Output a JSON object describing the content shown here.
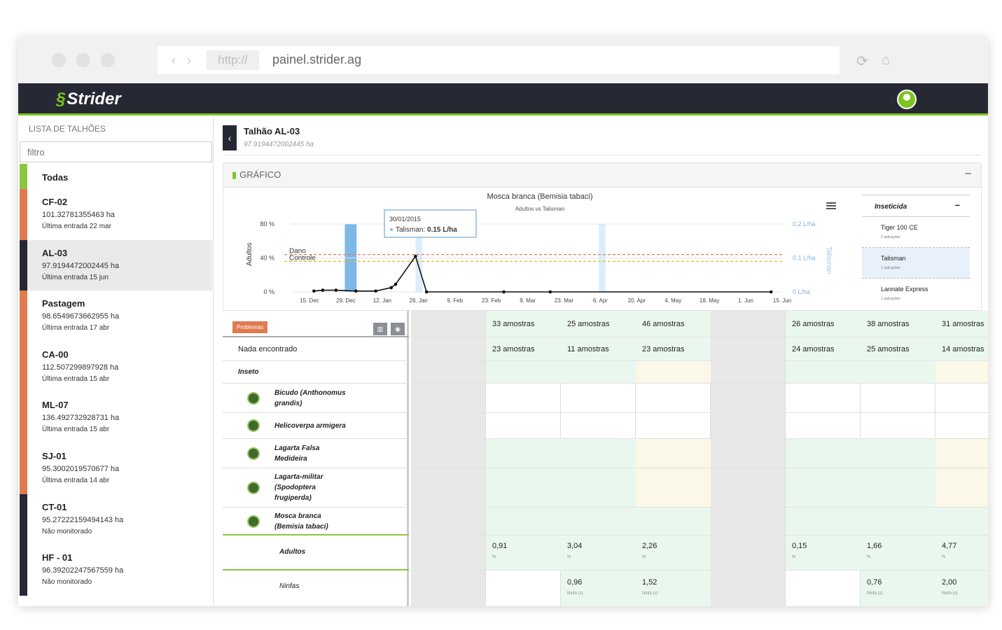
{
  "browser": {
    "protocol": "http://",
    "url": "painel.strider.ag"
  },
  "app": {
    "logo": "Strider"
  },
  "sidebar": {
    "title": "LISTA DE TALHÕES",
    "filter_placeholder": "filtro",
    "todas": "Todas",
    "items": [
      {
        "name": "CF-02",
        "area": "101.32781355463 ha",
        "last": "Última entrada 22 mar"
      },
      {
        "name": "AL-03",
        "area": "97.9194472002445 ha",
        "last": "Última entrada 15 jun"
      },
      {
        "name": "Pastagem",
        "area": "98.6549673662955 ha",
        "last": "Última entrada 17 abr"
      },
      {
        "name": "CA-00",
        "area": "112.507299897928 ha",
        "last": "Última entrada 15 abr"
      },
      {
        "name": "ML-07",
        "area": "136.492732928731 ha",
        "last": "Última entrada 15 abr"
      },
      {
        "name": "SJ-01",
        "area": "95.3002019570677 ha",
        "last": "Última entrada 14 abr"
      },
      {
        "name": "CT-01",
        "area": "95.27222159494143 ha",
        "last": "Não monitorado"
      },
      {
        "name": "HF - 01",
        "area": "96.39202247567559 ha",
        "last": "Não monitorado"
      }
    ]
  },
  "header": {
    "title": "Talhão AL-03",
    "subtitle": "97.9194472002445 ha"
  },
  "panel": {
    "title": "GRÁFICO",
    "minimize": "–"
  },
  "chart_data": {
    "type": "line",
    "title": "Mosca branca (Bemisia tabaci)",
    "subtitle": "Adultos vs Talisman",
    "ylabel": "Adultos",
    "y2label": "Talisman",
    "ylim": [
      0,
      80
    ],
    "y_ticks": [
      "80 %",
      "40 %",
      "0 %"
    ],
    "y2_ticks": [
      "0.2 L/ha",
      "0.1 L/ha",
      "0 L/ha"
    ],
    "x_ticks": [
      "15. Dec",
      "29. Dec",
      "12. Jan",
      "26. Jan",
      "9. Feb",
      "23. Feb",
      "9. Mar",
      "23. Mar",
      "6. Apr",
      "20. Apr",
      "4. May",
      "18. May",
      "1. Jun",
      "15. Jun"
    ],
    "thresholds": [
      {
        "name": "Dano",
        "value": 44,
        "color": "#e07a4f"
      },
      {
        "name": "Controle",
        "value": 36,
        "color": "#e8b820"
      }
    ],
    "series": [
      {
        "name": "Adultos",
        "values": [
          [
            -15,
            1
          ],
          [
            -11,
            2
          ],
          [
            -5,
            2
          ],
          [
            4,
            1
          ],
          [
            13,
            1
          ],
          [
            20,
            5
          ],
          [
            22,
            9
          ],
          [
            31,
            42
          ],
          [
            36,
            0
          ],
          [
            71,
            0
          ],
          [
            92,
            0
          ],
          [
            192,
            0
          ]
        ]
      }
    ],
    "tooltip": {
      "date": "30/01/2015",
      "series": "Talisman",
      "value": "0.15 L/ha"
    }
  },
  "legend": {
    "title": "Inseticida",
    "items": [
      {
        "name": "Tiger 100 CE",
        "sub": "2 aplicações"
      },
      {
        "name": "Talisman",
        "sub": "1 aplicações"
      },
      {
        "name": "Lannate Express",
        "sub": "1 aplicações"
      }
    ]
  },
  "table": {
    "problems": "Problemas",
    "nada": "Nada encontrado",
    "inseto": "Inseto",
    "insects": [
      "Bicudo (Anthonomus grandis)",
      "Helicoverpa armigera",
      "Lagarta Falsa Medideira",
      "Lagarta-militar (Spodoptera frugiperda)",
      "Mosca branca (Bemisia tabaci)"
    ],
    "adultos": "Adultos",
    "ninfas": "Ninfas",
    "samples": [
      "",
      "33 amostras",
      "25 amostras",
      "46 amostras",
      "",
      "26 amostras",
      "38 amostras",
      "31 amostras"
    ],
    "nada_samples": [
      "",
      "23 amostras",
      "11 amostras",
      "23 amostras",
      "",
      "24 amostras",
      "25 amostras",
      "14 amostras"
    ],
    "adult_vals": [
      "",
      "0,91",
      "3,04",
      "2,26",
      "",
      "0,15",
      "1,66",
      "4,77"
    ],
    "adult_unit": "%",
    "ninfa_vals": [
      "",
      "",
      "0,96",
      "1,52",
      "",
      "",
      "0,76",
      "2,00"
    ],
    "ninfa_unit": "Ninfa (s)"
  }
}
